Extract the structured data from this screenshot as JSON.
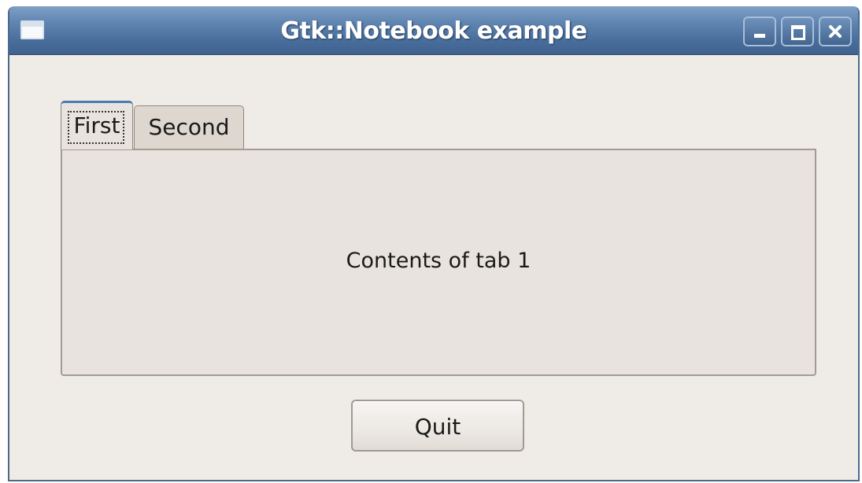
{
  "window": {
    "title": "Gtk::Notebook example",
    "controls": {
      "minimize": "minimize-icon",
      "maximize": "maximize-icon",
      "close": "close-icon"
    }
  },
  "notebook": {
    "tabs": [
      {
        "label": "First",
        "selected": true
      },
      {
        "label": "Second",
        "selected": false
      }
    ],
    "page_content": "Contents of tab 1"
  },
  "buttons": {
    "quit_label": "Quit"
  },
  "colors": {
    "titlebar": "#5f84b0",
    "window_bg": "#efebe7",
    "selected_tab_accent": "#4a7bb0"
  }
}
